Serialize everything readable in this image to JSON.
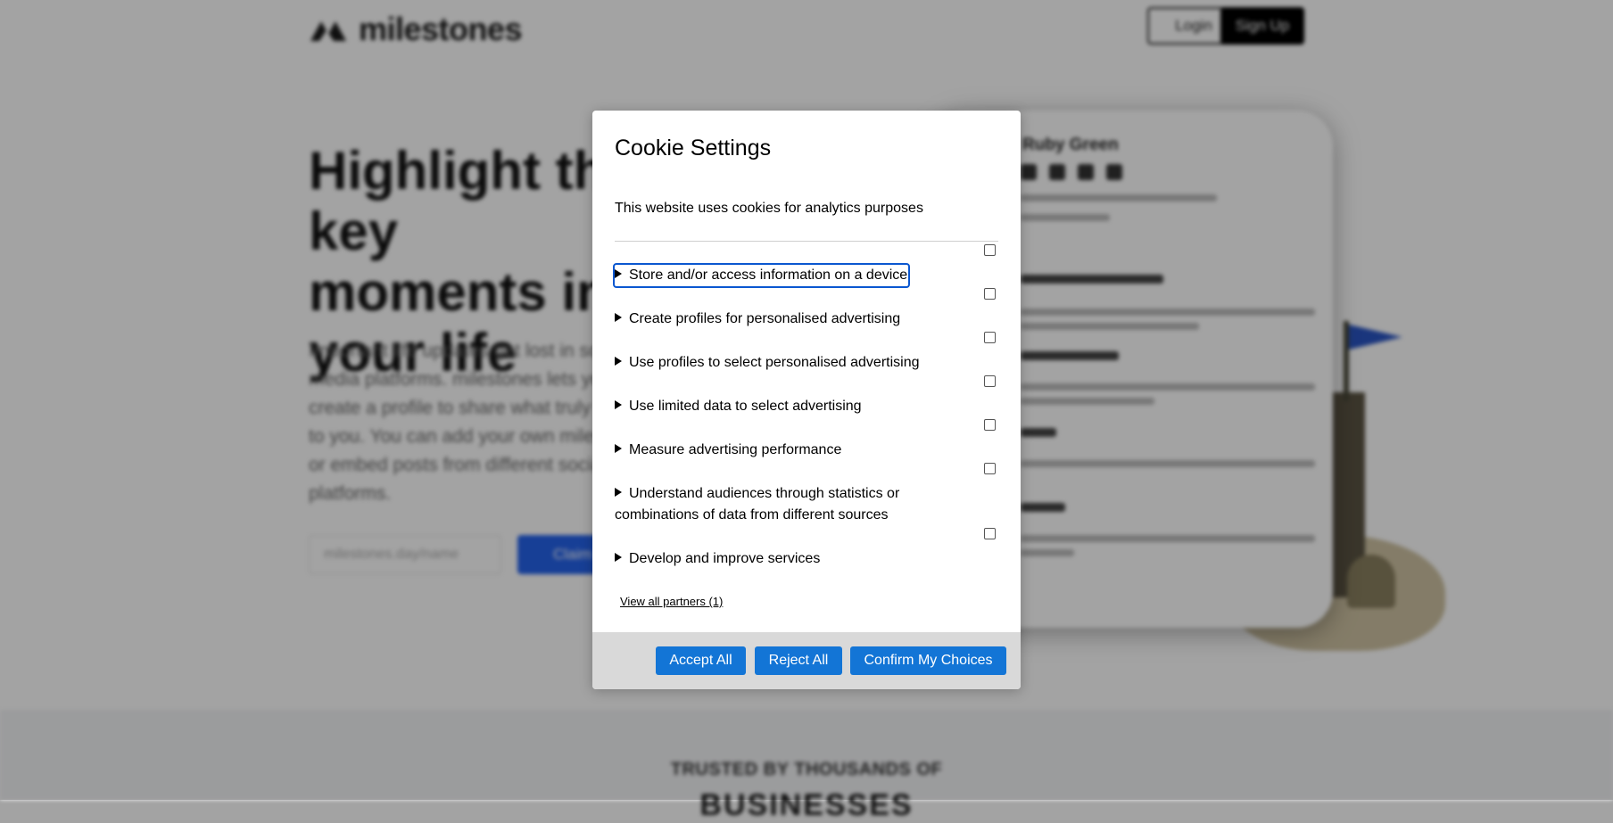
{
  "site": {
    "logo_text": "milestones",
    "login_label": "Login",
    "signup_label": "Sign Up",
    "hero_title": "Highlight the key moments in your life",
    "hero_desc": "Important life updates get lost in social media platforms. milestones lets you create a profile to share what truly matters to you. You can add your own milestones or embed posts from different social platforms.",
    "hero_input_placeholder": "milestones.day/name",
    "hero_button_label": "Claim",
    "card_name": "Ruby Green",
    "footer_line1": "TRUSTED BY THOUSANDS OF",
    "footer_line2": "BUSINESSES"
  },
  "modal": {
    "title": "Cookie Settings",
    "description": "This website uses cookies for analytics purposes",
    "purposes": [
      {
        "label": "Store and/or access information on a device",
        "checked": false
      },
      {
        "label": "Create profiles for personalised advertising",
        "checked": false
      },
      {
        "label": "Use profiles to select personalised advertising",
        "checked": false
      },
      {
        "label": "Use limited data to select advertising",
        "checked": false
      },
      {
        "label": "Measure advertising performance",
        "checked": false
      },
      {
        "label": "Understand audiences through statistics or combinations of data from different sources",
        "checked": false
      },
      {
        "label": "Develop and improve services",
        "checked": false
      }
    ],
    "partners_link": "View all partners (1)",
    "buttons": {
      "accept_all": "Accept All",
      "reject_all": "Reject All",
      "confirm": "Confirm My Choices"
    }
  },
  "colors": {
    "button_blue": "#1375d6",
    "focus_outline": "#0b57d0",
    "footer_gray": "#d9d9d9"
  }
}
